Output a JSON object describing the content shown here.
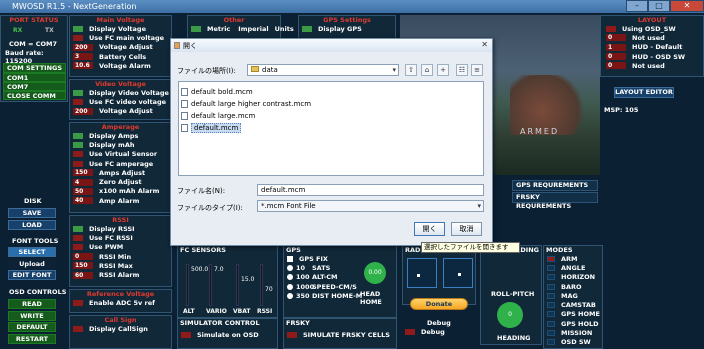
{
  "window": {
    "title": "MWOSD R1.5 - NextGeneration",
    "min": "–",
    "max": "□",
    "close": "✕"
  },
  "port": {
    "header": "PORT STATUS",
    "com": "COM = COM7",
    "baud": "Baud rate: 115200",
    "rx": "RX",
    "tx": "TX",
    "menu_label": "COM SETTINGS",
    "items": [
      "COM1",
      "COM7",
      "CLOSE COMM"
    ]
  },
  "disk": {
    "header": "DISK",
    "save": "SAVE",
    "load": "LOAD"
  },
  "font_tools": {
    "header": "FONT TOOLS",
    "select": "SELECT",
    "upload": "Upload",
    "edit": "EDIT FONT"
  },
  "osd_controls": {
    "header": "OSD CONTROLS",
    "read": "READ",
    "write": "WRITE",
    "default": "DEFAULT",
    "restart": "RESTART"
  },
  "main_voltage": {
    "header": "Main Voltage",
    "rows": [
      {
        "t": "Display Voltage",
        "kind": "sw",
        "c": "g"
      },
      {
        "t": "Use FC main voltage",
        "kind": "sw",
        "c": "r"
      },
      {
        "t": "Voltage Adjust",
        "kind": "num",
        "v": "200"
      },
      {
        "t": "Battery Cells",
        "kind": "num",
        "v": "3"
      },
      {
        "t": "Voltage Alarm",
        "kind": "num",
        "v": "10.6"
      }
    ]
  },
  "video_voltage": {
    "header": "Video Voltage",
    "rows": [
      {
        "t": "Display Video Voltage",
        "kind": "sw",
        "c": "g"
      },
      {
        "t": "Use FC video voltage",
        "kind": "sw",
        "c": "r"
      },
      {
        "t": "Voltage Adjust",
        "kind": "num",
        "v": "200"
      }
    ]
  },
  "amperage": {
    "header": "Amperage",
    "rows": [
      {
        "t": "Display Amps",
        "kind": "sw",
        "c": "g"
      },
      {
        "t": "Display mAh",
        "kind": "sw",
        "c": "g"
      },
      {
        "t": "Use Virtual Sensor",
        "kind": "sw",
        "c": "r"
      },
      {
        "t": "Use FC amperage",
        "kind": "sw",
        "c": "r"
      },
      {
        "t": "Amps Adjust",
        "kind": "num",
        "v": "150"
      },
      {
        "t": "Zero Adjust",
        "kind": "num",
        "v": "4"
      },
      {
        "t": "x100 mAh Alarm",
        "kind": "num",
        "v": "50"
      },
      {
        "t": "Amp Alarm",
        "kind": "num",
        "v": "40"
      }
    ]
  },
  "rssi": {
    "header": "RSSI",
    "rows": [
      {
        "t": "Display RSSI",
        "kind": "sw",
        "c": "g"
      },
      {
        "t": "Use FC RSSI",
        "kind": "sw",
        "c": "r"
      },
      {
        "t": "Use PWM",
        "kind": "sw",
        "c": "r"
      },
      {
        "t": "RSSI Min",
        "kind": "num",
        "v": "0"
      },
      {
        "t": "RSSI Max",
        "kind": "num",
        "v": "150"
      },
      {
        "t": "RSSI Alarm",
        "kind": "num",
        "v": "60"
      }
    ]
  },
  "ref_voltage": {
    "header": "Reference Voltage",
    "rows": [
      {
        "t": "Enable ADC 5v ref",
        "kind": "sw",
        "c": "r"
      }
    ]
  },
  "callsign": {
    "header": "Call Sign",
    "rows": [
      {
        "t": "Display CallSign",
        "kind": "sw",
        "c": "r"
      }
    ]
  },
  "other": {
    "header": "Other",
    "metric": "Metric",
    "imperial": "Imperial",
    "units": "Units"
  },
  "gps_settings": {
    "header": "GPS Settings",
    "display": "Display GPS"
  },
  "layout": {
    "header": "LAYOUT",
    "rows": [
      {
        "t": "Using OSD_SW",
        "kind": "sw",
        "c": "r"
      },
      {
        "t": "Not used",
        "kind": "num",
        "v": "0"
      },
      {
        "t": "HUD - Default",
        "kind": "num",
        "v": "1"
      },
      {
        "t": "HUD - OSD SW",
        "kind": "num",
        "v": "0"
      },
      {
        "t": "Not used",
        "kind": "num",
        "v": "0"
      }
    ],
    "editor": "LAYOUT EDITOR",
    "msp": "MSP: 105"
  },
  "preview": {
    "overlay": "ARMED"
  },
  "req": {
    "gps": "GPS REQUREMENTS",
    "frsky": "FRSKY REQUREMENTS"
  },
  "fc_sensors": {
    "header": "FC SENSORS",
    "values": [
      "500.0",
      "7.0",
      "15.0",
      "70"
    ],
    "labels": [
      "ALT",
      "VARIO",
      "VBAT",
      "RSSI"
    ]
  },
  "gps_panel": {
    "header": "GPS",
    "fix": "GPS FIX",
    "rows": [
      [
        "10",
        "SATS"
      ],
      [
        "100",
        "ALT-CM"
      ],
      [
        "1000",
        "SPEED-CM/S"
      ],
      [
        "350",
        "DIST HOME-M"
      ]
    ],
    "home_val": "0.00",
    "home_label": "HEAD HOME"
  },
  "radio": {
    "header": "RADIO"
  },
  "heading": {
    "header": "HEADING",
    "roll": "ROLL-PITCH",
    "heading_label": "HEADING",
    "heading_val": "0"
  },
  "donate": "Donate",
  "debug1": "Debug",
  "debug2": "Debug",
  "modes": {
    "header": "MODES",
    "items": [
      "ARM",
      "ANGLE",
      "HORIZON",
      "BARO",
      "MAG",
      "CAMSTAB",
      "GPS HOME",
      "GPS HOLD",
      "MISSION",
      "OSD SW"
    ]
  },
  "simulator": {
    "header": "SIMULATOR CONTROL",
    "item": "Simulate on OSD"
  },
  "frsky": {
    "header": "FRSKY",
    "item": "SIMULATE FRSKY CELLS"
  },
  "tooltip": "選択したファイルを開きます",
  "dialog": {
    "title": "開く",
    "lookin_label": "ファイルの場所(I):",
    "lookin_value": "data",
    "files": [
      "default bold.mcm",
      "default large higher contrast.mcm",
      "default large.mcm",
      "default.mcm"
    ],
    "name_label": "ファイル名(N):",
    "name_value": "default.mcm",
    "type_label": "ファイルのタイプ(I):",
    "type_value": "*.mcm Font File",
    "open": "開く",
    "cancel": "取消"
  }
}
